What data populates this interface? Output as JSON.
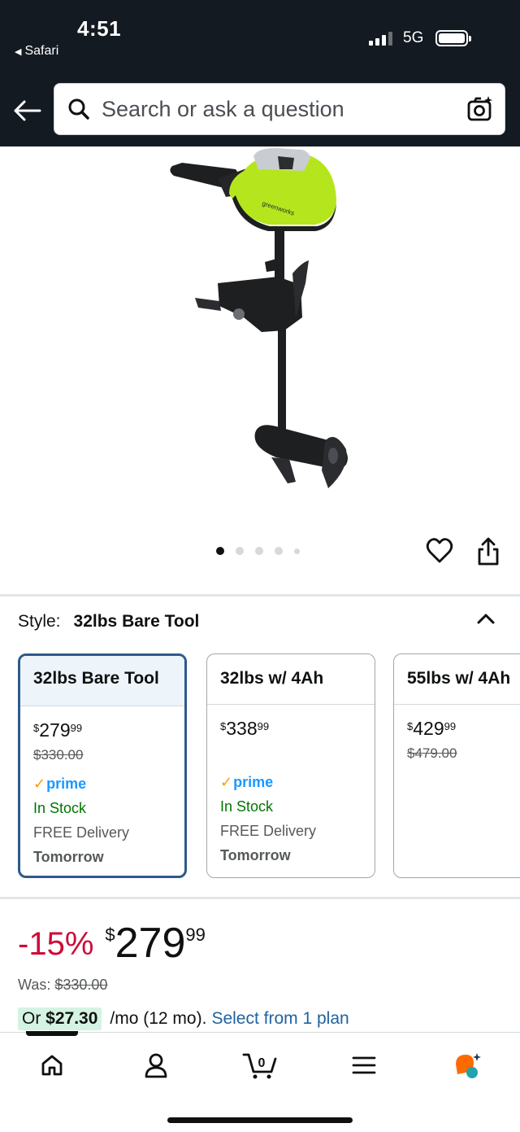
{
  "status_bar": {
    "time": "4:51",
    "back_app": "Safari",
    "network": "5G"
  },
  "header": {
    "search_placeholder": "Search or ask a question"
  },
  "gallery": {
    "image_count": 5,
    "active_index": 0,
    "product_brand_marking": "greenworks"
  },
  "style_selector": {
    "label": "Style:",
    "value": "32lbs Bare Tool",
    "options": [
      {
        "title": "32lbs Bare Tool",
        "price_symbol": "$",
        "price_whole": "279",
        "price_cents": "99",
        "was": "$330.00",
        "prime_check": "✓",
        "prime": "prime",
        "stock": "In Stock",
        "delivery": "FREE Delivery",
        "when": "Tomorrow",
        "selected": true
      },
      {
        "title": "32lbs w/ 4Ah",
        "price_symbol": "$",
        "price_whole": "338",
        "price_cents": "99",
        "was": "",
        "prime_check": "✓",
        "prime": "prime",
        "stock": "In Stock",
        "delivery": "FREE Delivery",
        "when": "Tomorrow",
        "selected": false
      },
      {
        "title": "55lbs w/ 4Ah",
        "price_symbol": "$",
        "price_whole": "429",
        "price_cents": "99",
        "was": "$479.00",
        "selected": false
      }
    ]
  },
  "price": {
    "discount": "-15%",
    "symbol": "$",
    "whole": "279",
    "cents": "99",
    "was_label": "Was:",
    "was_value": "$330.00"
  },
  "installment": {
    "or_label": "Or",
    "amount": "$27.30",
    "terms": "/mo (12 mo).",
    "link": "Select from 1 plan"
  },
  "tabbar": {
    "cart_count": "0",
    "items": [
      "home-icon",
      "account-icon",
      "cart-icon",
      "menu-icon",
      "rufus-icon"
    ]
  },
  "colors": {
    "header_bg": "#131a22",
    "selected_border": "#2d5a8a",
    "discount": "#cc0c39",
    "in_stock": "#007600",
    "link": "#2162a1",
    "prime_blue": "#1a98ff",
    "prime_check": "#ff9900",
    "product_green": "#b5e61d"
  }
}
